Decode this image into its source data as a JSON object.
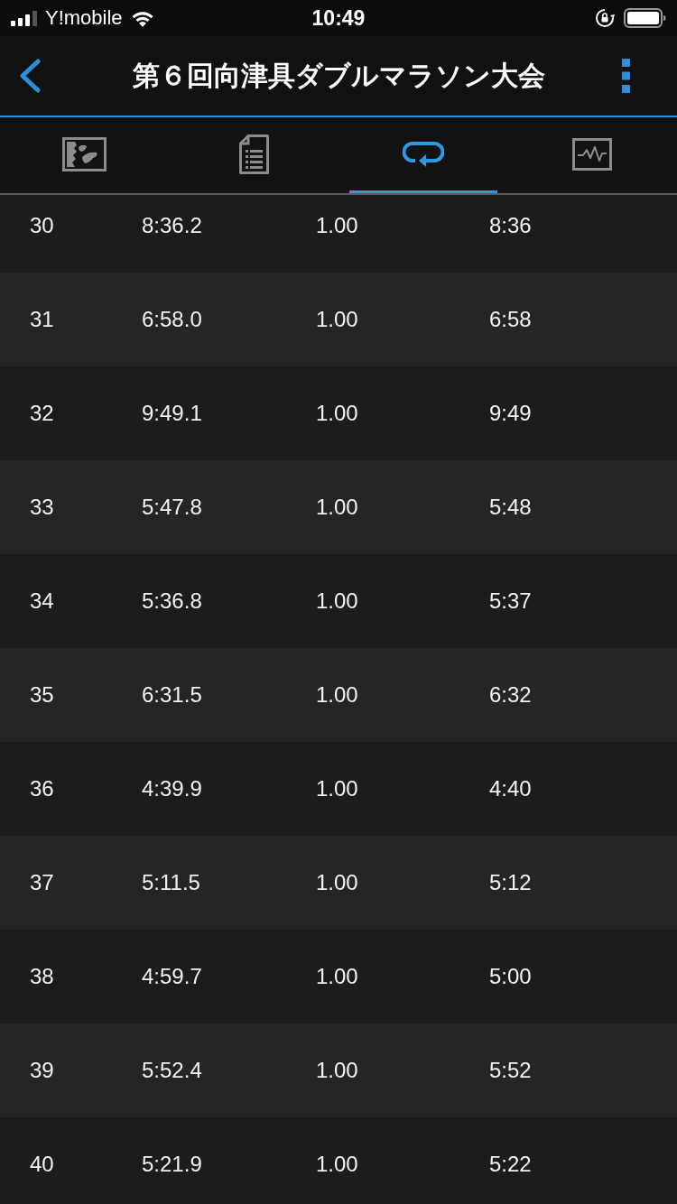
{
  "status_bar": {
    "carrier": "Y!mobile",
    "time": "10:49"
  },
  "nav_bar": {
    "title": "第６回向津具ダブルマラソン大会"
  },
  "tabs": [
    {
      "kind": "picture",
      "selected": false
    },
    {
      "kind": "document",
      "selected": false
    },
    {
      "kind": "loop",
      "selected": true
    },
    {
      "kind": "pulse",
      "selected": false
    }
  ],
  "table": {
    "rows": [
      [
        "30",
        "8:36.2",
        "1.00",
        "8:36"
      ],
      [
        "31",
        "6:58.0",
        "1.00",
        "6:58"
      ],
      [
        "32",
        "9:49.1",
        "1.00",
        "9:49"
      ],
      [
        "33",
        "5:47.8",
        "1.00",
        "5:48"
      ],
      [
        "34",
        "5:36.8",
        "1.00",
        "5:37"
      ],
      [
        "35",
        "6:31.5",
        "1.00",
        "6:32"
      ],
      [
        "36",
        "4:39.9",
        "1.00",
        "4:40"
      ],
      [
        "37",
        "5:11.5",
        "1.00",
        "5:12"
      ],
      [
        "38",
        "4:59.7",
        "1.00",
        "5:00"
      ],
      [
        "39",
        "5:52.4",
        "1.00",
        "5:52"
      ],
      [
        "40",
        "5:21.9",
        "1.00",
        "5:22"
      ]
    ]
  }
}
